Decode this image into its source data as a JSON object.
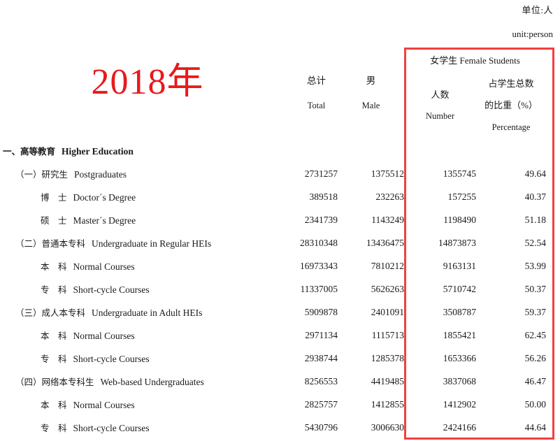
{
  "unit": {
    "cn": "单位:人",
    "en": "unit:person"
  },
  "header": {
    "year": "2018年",
    "total": {
      "cn": "总计",
      "en": "Total"
    },
    "male": {
      "cn": "男",
      "en": "Male"
    },
    "female_group": "女学生 Female Students",
    "female_number": {
      "l1": "人数",
      "l2": "",
      "l3": "Number"
    },
    "female_percentage": {
      "l1": "占学生总数",
      "l2": "的比重（%）",
      "l3": "Percentage"
    }
  },
  "highlight": {
    "color": "#f1413f",
    "name": "female-students-columns"
  },
  "rows": [
    {
      "level": 0,
      "cn": "一、高等教育",
      "en": "Higher Education",
      "total": "",
      "male": "",
      "female_number": "",
      "female_percentage": ""
    },
    {
      "level": 1,
      "cn": "（一）研究生",
      "en": "Postgraduates",
      "total": "2731257",
      "male": "1375512",
      "female_number": "1355745",
      "female_percentage": "49.64"
    },
    {
      "level": 2,
      "cn": "博　士",
      "en": "Doctor´s Degree",
      "total": "389518",
      "male": "232263",
      "female_number": "157255",
      "female_percentage": "40.37"
    },
    {
      "level": 2,
      "cn": "硕　士",
      "en": "Master´s Degree",
      "total": "2341739",
      "male": "1143249",
      "female_number": "1198490",
      "female_percentage": "51.18"
    },
    {
      "level": 1,
      "cn": "（二）普通本专科",
      "en": "Undergraduate in Regular HEIs",
      "total": "28310348",
      "male": "13436475",
      "female_number": "14873873",
      "female_percentage": "52.54"
    },
    {
      "level": 2,
      "cn": "本　科",
      "en": "Normal Courses",
      "total": "16973343",
      "male": "7810212",
      "female_number": "9163131",
      "female_percentage": "53.99"
    },
    {
      "level": 2,
      "cn": "专　科",
      "en": "Short-cycle Courses",
      "total": "11337005",
      "male": "5626263",
      "female_number": "5710742",
      "female_percentage": "50.37"
    },
    {
      "level": 1,
      "cn": "（三）成人本专科",
      "en": "Undergraduate in Adult HEIs",
      "total": "5909878",
      "male": "2401091",
      "female_number": "3508787",
      "female_percentage": "59.37"
    },
    {
      "level": 2,
      "cn": "本　科",
      "en": "Normal Courses",
      "total": "2971134",
      "male": "1115713",
      "female_number": "1855421",
      "female_percentage": "62.45"
    },
    {
      "level": 2,
      "cn": "专　科",
      "en": "Short-cycle Courses",
      "total": "2938744",
      "male": "1285378",
      "female_number": "1653366",
      "female_percentage": "56.26"
    },
    {
      "level": 1,
      "cn": "（四）网络本专科生",
      "en": "Web-based Undergraduates",
      "total": "8256553",
      "male": "4419485",
      "female_number": "3837068",
      "female_percentage": "46.47"
    },
    {
      "level": 2,
      "cn": "本　科",
      "en": "Normal Courses",
      "total": "2825757",
      "male": "1412855",
      "female_number": "1412902",
      "female_percentage": "50.00"
    },
    {
      "level": 2,
      "cn": "专　科",
      "en": "Short-cycle Courses",
      "total": "5430796",
      "male": "3006630",
      "female_number": "2424166",
      "female_percentage": "44.64"
    }
  ]
}
